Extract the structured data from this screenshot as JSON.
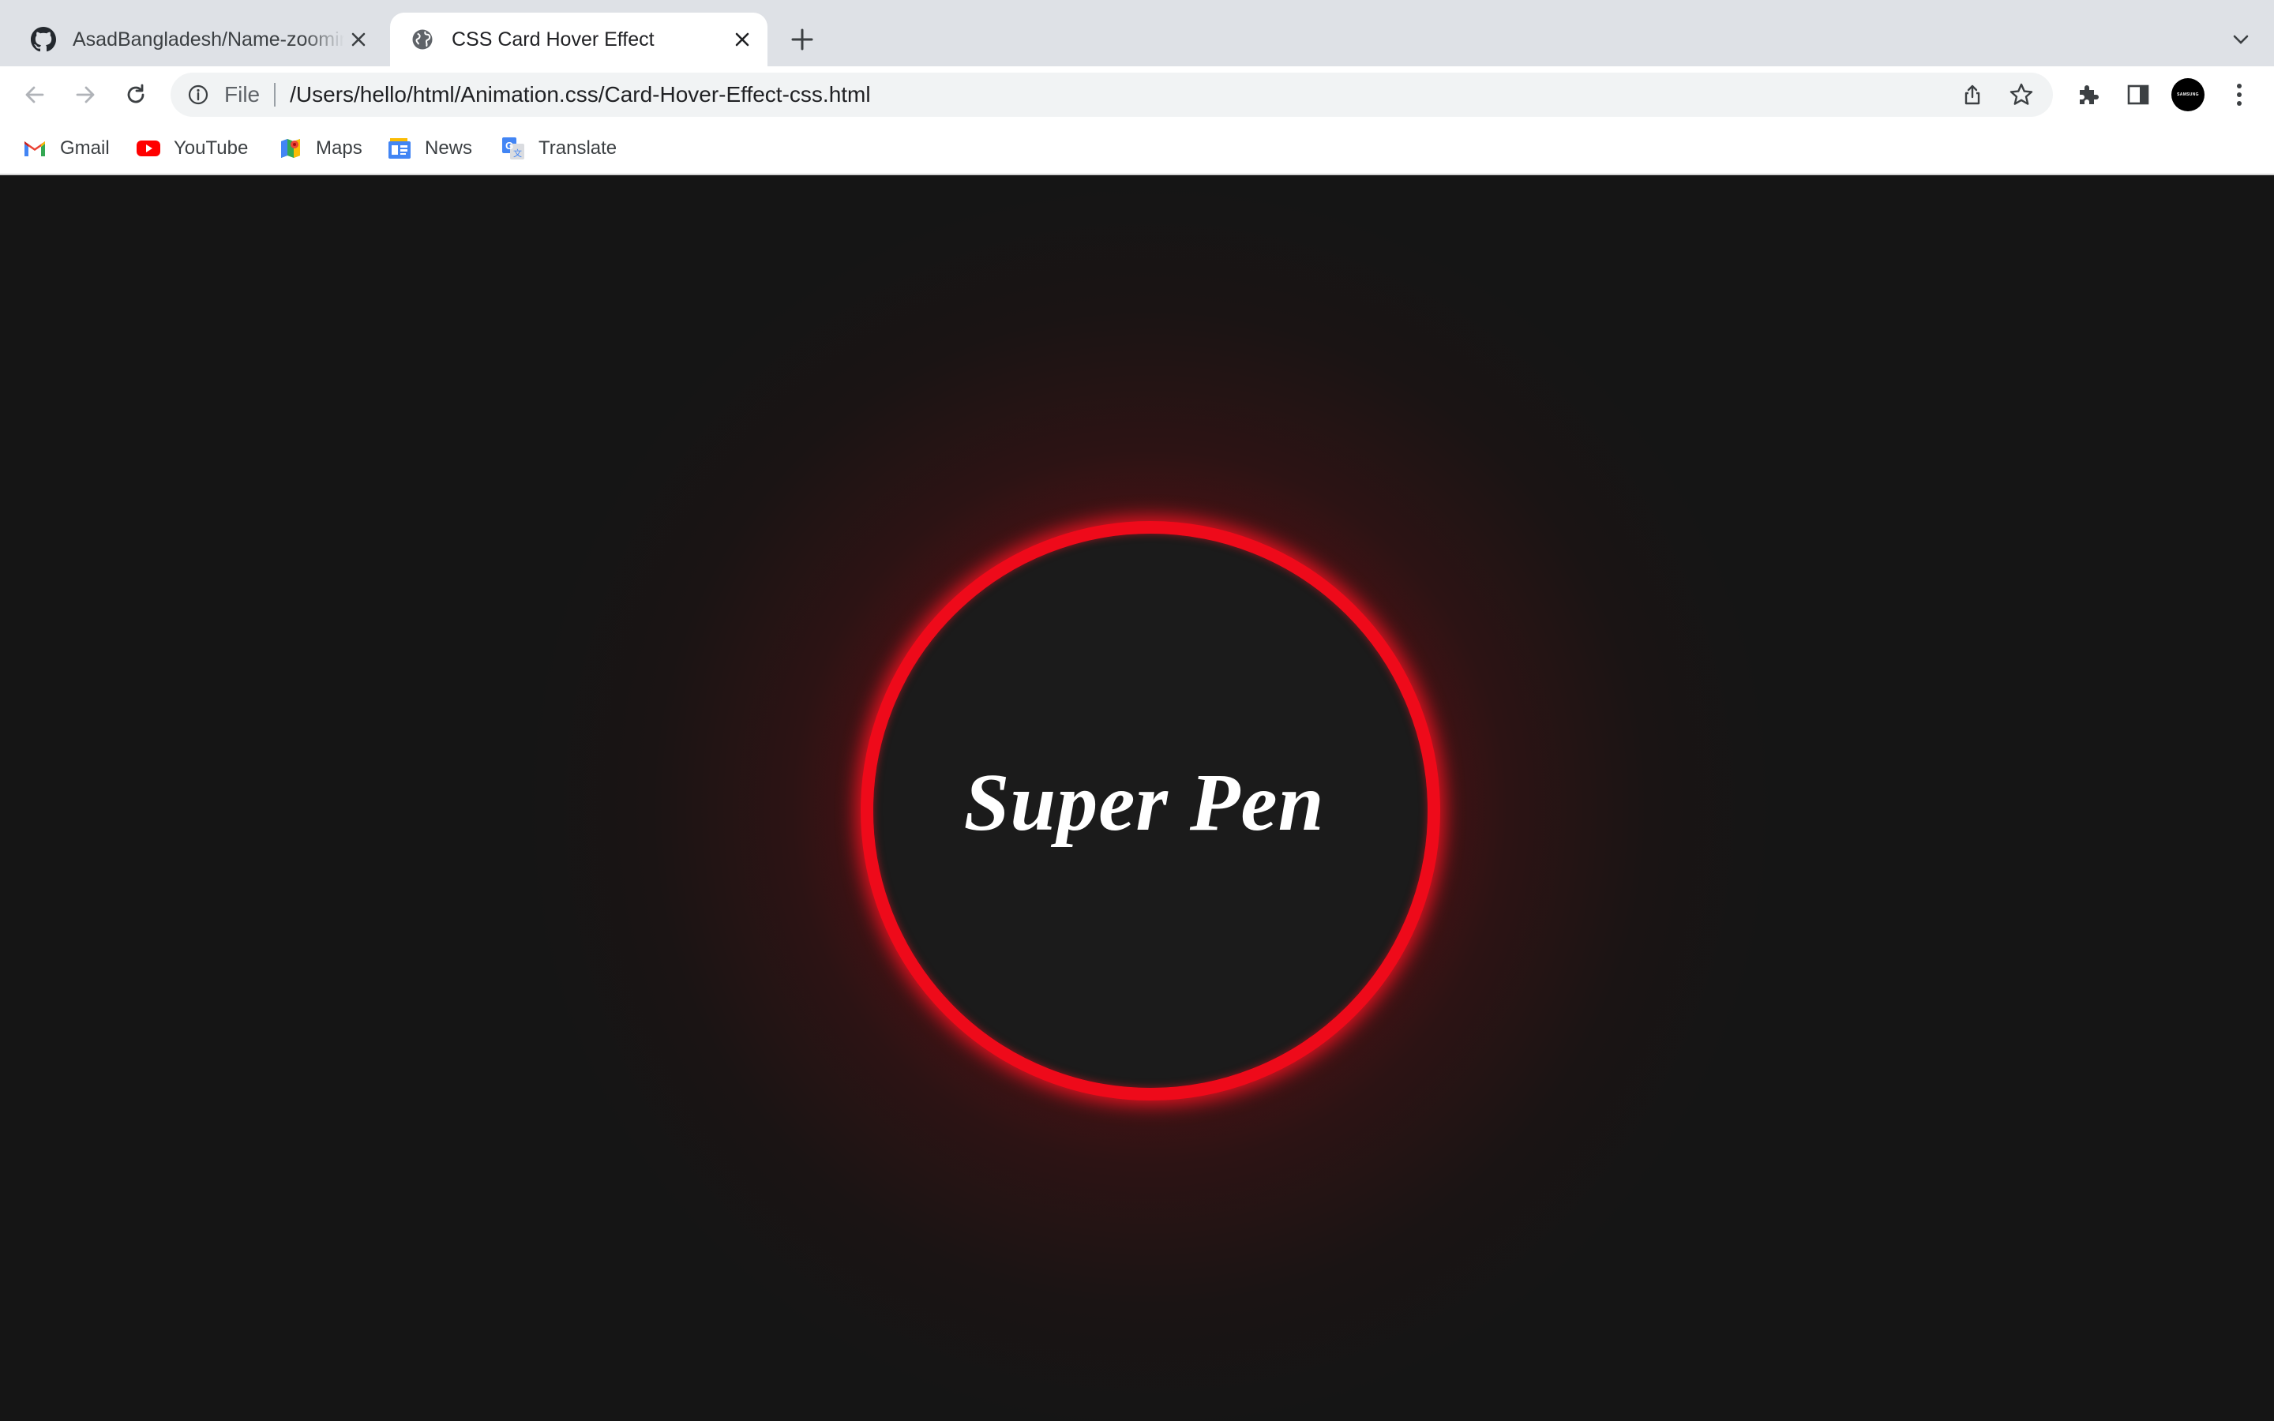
{
  "browser": {
    "tabs": [
      {
        "title": "AsadBangladesh/Name-zooming",
        "favicon": "github-icon",
        "active": false
      },
      {
        "title": "CSS Card Hover Effect",
        "favicon": "globe-icon",
        "active": true
      }
    ],
    "address": {
      "scheme_label": "File",
      "url": "/Users/hello/html/Animation.css/Card-Hover-Effect-css.html"
    },
    "profile": {
      "label": "SAMSUNG"
    },
    "bookmarks": [
      {
        "label": "Gmail",
        "icon": "gmail-icon"
      },
      {
        "label": "YouTube",
        "icon": "youtube-icon"
      },
      {
        "label": "Maps",
        "icon": "maps-icon"
      },
      {
        "label": "News",
        "icon": "news-icon"
      },
      {
        "label": "Translate",
        "icon": "translate-icon"
      }
    ]
  },
  "page": {
    "card_text": "Super Pen",
    "background_color": "#151515",
    "ring_color": "#ee0a1a"
  }
}
